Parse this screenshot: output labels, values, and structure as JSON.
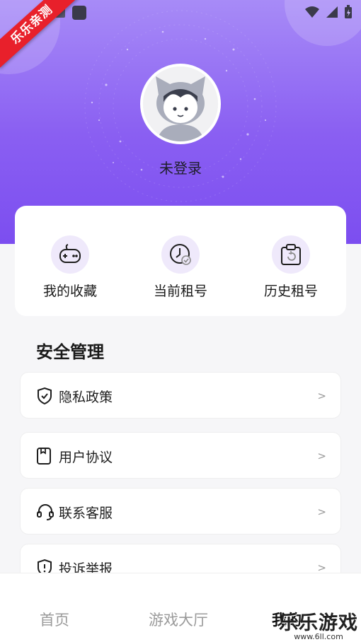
{
  "ribbon": "乐乐亲测",
  "profile": {
    "status": "未登录"
  },
  "quick_actions": [
    {
      "label": "我的收藏",
      "icon": "gamepad-icon"
    },
    {
      "label": "当前租号",
      "icon": "clock-check-icon"
    },
    {
      "label": "历史租号",
      "icon": "clipboard-history-icon"
    }
  ],
  "security": {
    "title": "安全管理",
    "items": [
      {
        "label": "隐私政策",
        "icon": "shield-check-icon",
        "chevron": ">"
      },
      {
        "label": "用户协议",
        "icon": "document-icon",
        "chevron": ">"
      },
      {
        "label": "联系客服",
        "icon": "headset-icon",
        "chevron": ">"
      },
      {
        "label": "投诉举报",
        "icon": "alert-shield-icon",
        "chevron": ">"
      }
    ]
  },
  "tabs": [
    {
      "label": "首页"
    },
    {
      "label": "游戏大厅"
    },
    {
      "label": "我的"
    }
  ],
  "watermark": {
    "title": "乐乐游戏",
    "url": "www.6ll.com"
  },
  "colors": {
    "accent": "#7c4ef0",
    "card_bg": "#ffffff",
    "page_bg": "#f6f6f8"
  }
}
